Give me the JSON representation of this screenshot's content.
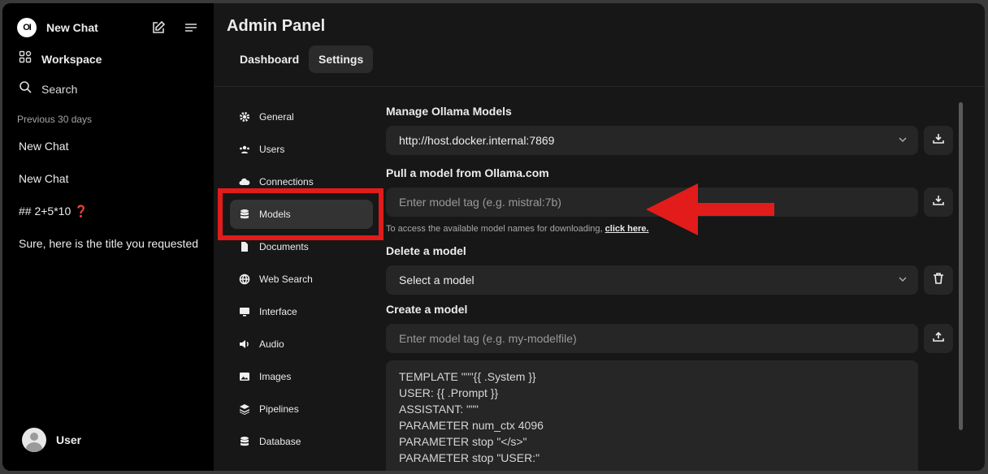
{
  "sidebar": {
    "logo_text": "OI",
    "new_chat": "New Chat",
    "workspace": "Workspace",
    "search": "Search",
    "section_label": "Previous 30 days",
    "chats": [
      "New Chat",
      "New Chat",
      "## 2+5*10 ❓",
      "Sure, here is the title you requested"
    ],
    "user": "User"
  },
  "header": {
    "title": "Admin Panel",
    "tabs": [
      "Dashboard",
      "Settings"
    ],
    "active_tab": "Settings"
  },
  "settings_nav": {
    "items": [
      "General",
      "Users",
      "Connections",
      "Models",
      "Documents",
      "Web Search",
      "Interface",
      "Audio",
      "Images",
      "Pipelines",
      "Database"
    ],
    "icons": [
      "gear-icon",
      "users-icon",
      "cloud-icon",
      "database-icon",
      "document-icon",
      "globe-icon",
      "monitor-icon",
      "speaker-icon",
      "image-icon",
      "layers-icon",
      "database-icon"
    ],
    "active": "Models"
  },
  "models": {
    "manage_label": "Manage Ollama Models",
    "ollama_url": "http://host.docker.internal:7869",
    "pull_label": "Pull a model from Ollama.com",
    "pull_placeholder": "Enter model tag (e.g. mistral:7b)",
    "hint_text": "To access the available model names for downloading, ",
    "hint_link": "click here.",
    "delete_label": "Delete a model",
    "delete_select": "Select a model",
    "create_label": "Create a model",
    "create_placeholder": "Enter model tag (e.g. my-modelfile)",
    "modelfile_lines": [
      "TEMPLATE \"\"\"{{ .System }}",
      "USER: {{ .Prompt }}",
      "ASSISTANT: \"\"\"",
      "PARAMETER num_ctx 4096",
      "PARAMETER stop \"</s>\"",
      "PARAMETER stop \"USER:\""
    ]
  },
  "annotation_color": "#e21b1b"
}
